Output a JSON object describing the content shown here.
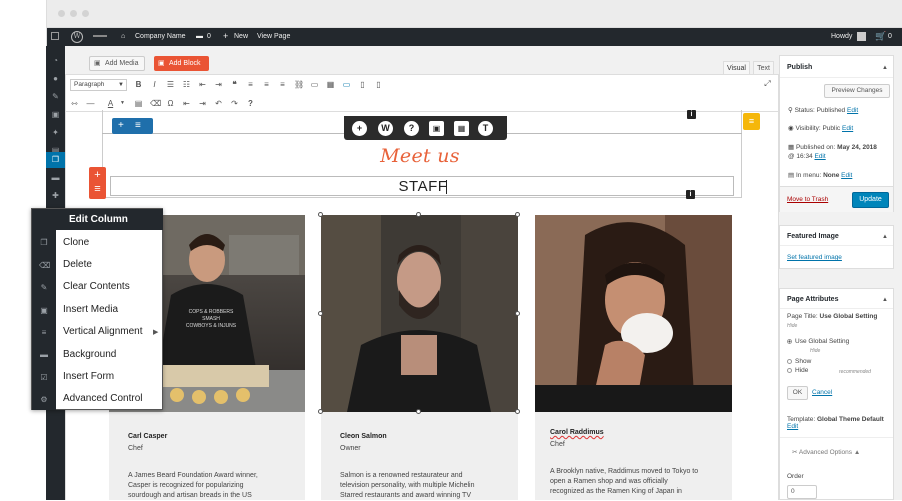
{
  "adminbar": {
    "site_name": "Company Name",
    "comments_count": "0",
    "new_label": "New",
    "view_page": "View Page",
    "greeting": "Howdy",
    "cart_count": "0"
  },
  "editor": {
    "add_media": "Add Media",
    "add_block": "Add Block",
    "tab_visual": "Visual",
    "tab_text": "Text",
    "format_select": "Paragraph",
    "heading_script": "Meet us",
    "heading_main": "STAFF"
  },
  "context_menu": {
    "title": "Edit Column",
    "items": [
      "Clone",
      "Delete",
      "Clear Contents",
      "Insert Media",
      "Vertical Alignment",
      "Background",
      "Insert Form",
      "Advanced Control"
    ]
  },
  "staff": [
    {
      "name": "Carl Casper",
      "role": "Chef",
      "desc_lines": [
        "A James Beard Foundation Award winner,",
        "Casper is recognized for popularizing",
        "sourdough and artisan breads in the US"
      ],
      "shirt_text": [
        "COPS & ROBBERS",
        "SMASH",
        "COWBOYS & INJUNS"
      ]
    },
    {
      "name": "Cleon Salmon",
      "role": "Owner",
      "desc_lines": [
        "Salmon is a renowned restaurateur and",
        "television personality, with multiple Michelin",
        "Starred restaurants and award winning TV"
      ]
    },
    {
      "name": "Carol Raddimus",
      "role": "Chef",
      "desc_lines": [
        "A Brooklyn native, Raddimus moved to Tokyo to",
        "open a Ramen shop and was officially",
        "recognized as the Ramen King of Japan in"
      ]
    }
  ],
  "sidebar": {
    "publish": {
      "title": "Publish",
      "preview": "Preview Changes",
      "status_label": "Status:",
      "status_value": "Published",
      "visibility_label": "Visibility:",
      "visibility_value": "Public",
      "published_on_label": "Published on:",
      "published_on_value": "May 24, 2018",
      "published_time": "@ 16:34",
      "menu_label": "In menu:",
      "menu_value": "None",
      "edit": "Edit",
      "trash": "Move to Trash",
      "update": "Update"
    },
    "featured": {
      "title": "Featured Image",
      "link": "Set featured image"
    },
    "attributes": {
      "title": "Page Attributes",
      "page_title_label": "Page Title:",
      "page_title_value": "Use Global Setting",
      "hide1": "Hide",
      "opt_global": "Use Global Setting",
      "hide2": "Hide",
      "opt_show": "Show",
      "opt_hide": "Hide",
      "recommended": "recommended",
      "ok": "OK",
      "cancel": "Cancel",
      "template_label": "Template:",
      "template_value": "Global Theme Default",
      "advanced": "Advanced Options",
      "order_label": "Order",
      "order_value": "0"
    }
  },
  "colors": {
    "accent_orange": "#ea5434",
    "wp_blue": "#0073aa",
    "admin_dark": "#23282d",
    "script_color": "#e8623a"
  }
}
